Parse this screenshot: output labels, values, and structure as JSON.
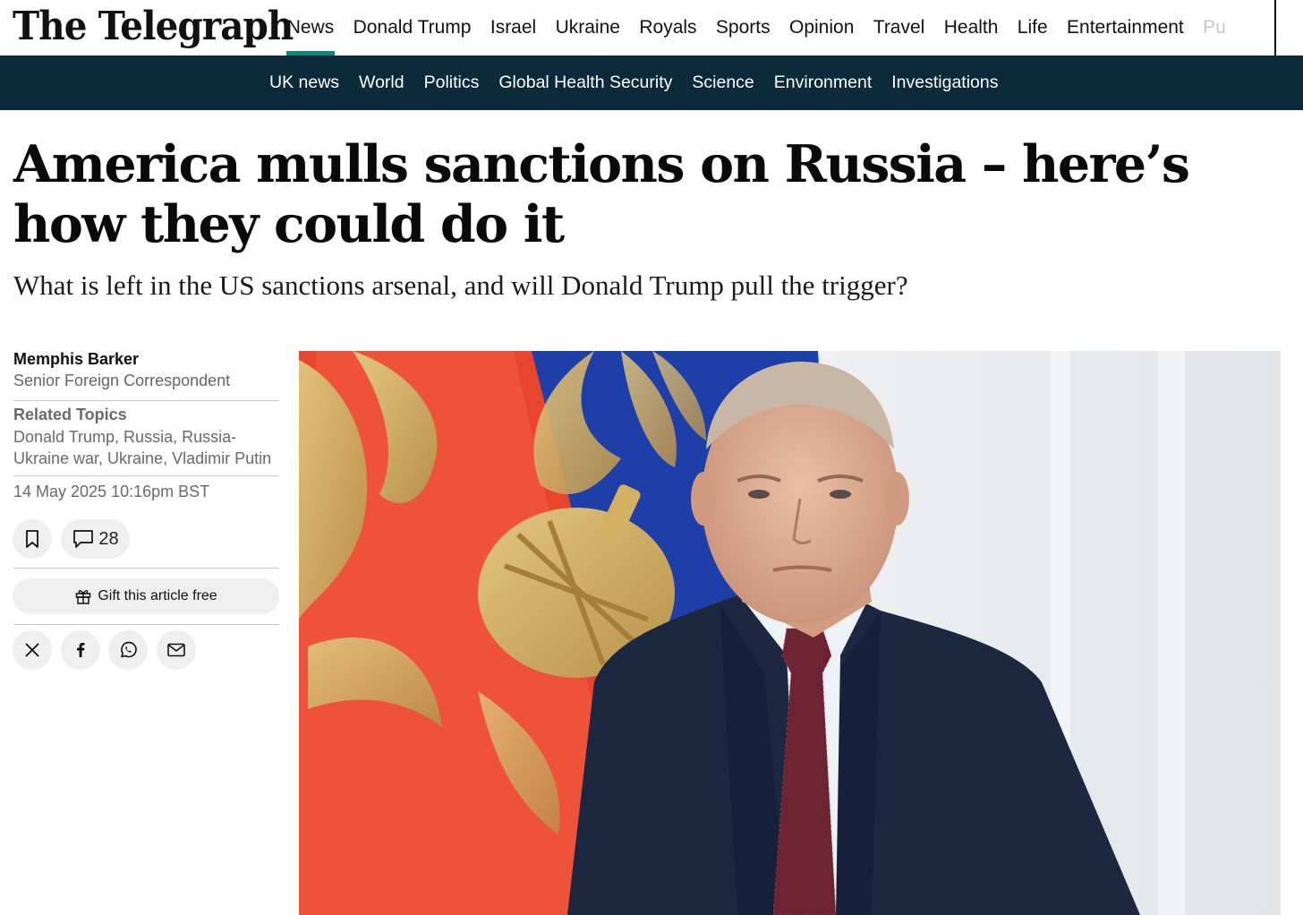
{
  "brand": {
    "name": "The Telegraph"
  },
  "primary_nav": {
    "items": [
      "News",
      "Donald Trump",
      "Israel",
      "Ukraine",
      "Royals",
      "Sports",
      "Opinion",
      "Travel",
      "Health",
      "Life",
      "Entertainment",
      "Pu"
    ],
    "active": "News"
  },
  "secondary_nav": {
    "items": [
      "UK news",
      "World",
      "Politics",
      "Global Health Security",
      "Science",
      "Environment",
      "Investigations"
    ]
  },
  "article": {
    "headline": "America mulls sanctions on Russia – here’s how they could do it",
    "standfirst": "What is left in the US sanctions arsenal, and will Donald Trump pull the trigger?",
    "author": {
      "name": "Memphis Barker",
      "role": "Senior Foreign Correspondent"
    },
    "related_topics_title": "Related Topics",
    "related_topics": "Donald Trump, Russia, Russia-Ukraine war, Ukraine, Vladimir Putin",
    "date": "14 May 2025 10:16pm BST",
    "comment_count": "28",
    "gift_label": "Gift this article free"
  },
  "icons": {
    "bookmark": "bookmark-icon",
    "comment": "comment-icon",
    "gift": "gift-icon",
    "share": [
      "x-icon",
      "facebook-icon",
      "whatsapp-icon",
      "email-icon"
    ]
  },
  "colors": {
    "accent": "#0f8a7a",
    "subnav_bg": "#0c2a3a",
    "flag_red": "#e8452f",
    "flag_blue": "#1f3fa8",
    "suit": "#1c2740"
  }
}
